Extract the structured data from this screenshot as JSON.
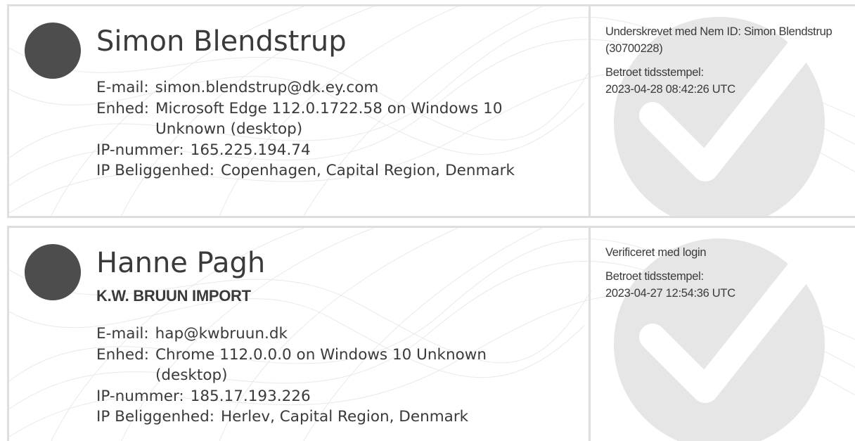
{
  "signers": [
    {
      "name": "Simon Blendstrup",
      "company": "",
      "email_label": "E-mail:",
      "email": "simon.blendstrup@dk.ey.com",
      "device_label": "Enhed:",
      "device": "Microsoft Edge 112.0.1722.58 on Windows 10 Unknown (desktop)",
      "ip_label": "IP-nummer:",
      "ip": "165.225.194.74",
      "location_label": "IP Beliggenhed:",
      "location": "Copenhagen, Capital Region, Denmark",
      "verification": "Underskrevet med Nem ID: Simon Blendstrup (30700228)",
      "timestamp_label": "Betroet tidsstempel:",
      "timestamp": "2023-04-28 08:42:26 UTC"
    },
    {
      "name": "Hanne Pagh",
      "company": "K.W. BRUUN IMPORT",
      "email_label": "E-mail:",
      "email": "hap@kwbruun.dk",
      "device_label": "Enhed:",
      "device": "Chrome 112.0.0.0 on Windows 10 Unknown (desktop)",
      "ip_label": "IP-nummer:",
      "ip": "185.17.193.226",
      "location_label": "IP Beliggenhed:",
      "location": "Herlev, Capital Region, Denmark",
      "verification": "Verificeret med login",
      "timestamp_label": "Betroet tidsstempel:",
      "timestamp": "2023-04-27 12:54:36 UTC"
    }
  ],
  "colors": {
    "text": "#3a3a3a",
    "avatar": "#4d4d4d",
    "border": "#dedede",
    "check_circle": "#e6e6e6"
  },
  "icons": {
    "avatar": "avatar-circle",
    "check": "check-mark-icon"
  }
}
